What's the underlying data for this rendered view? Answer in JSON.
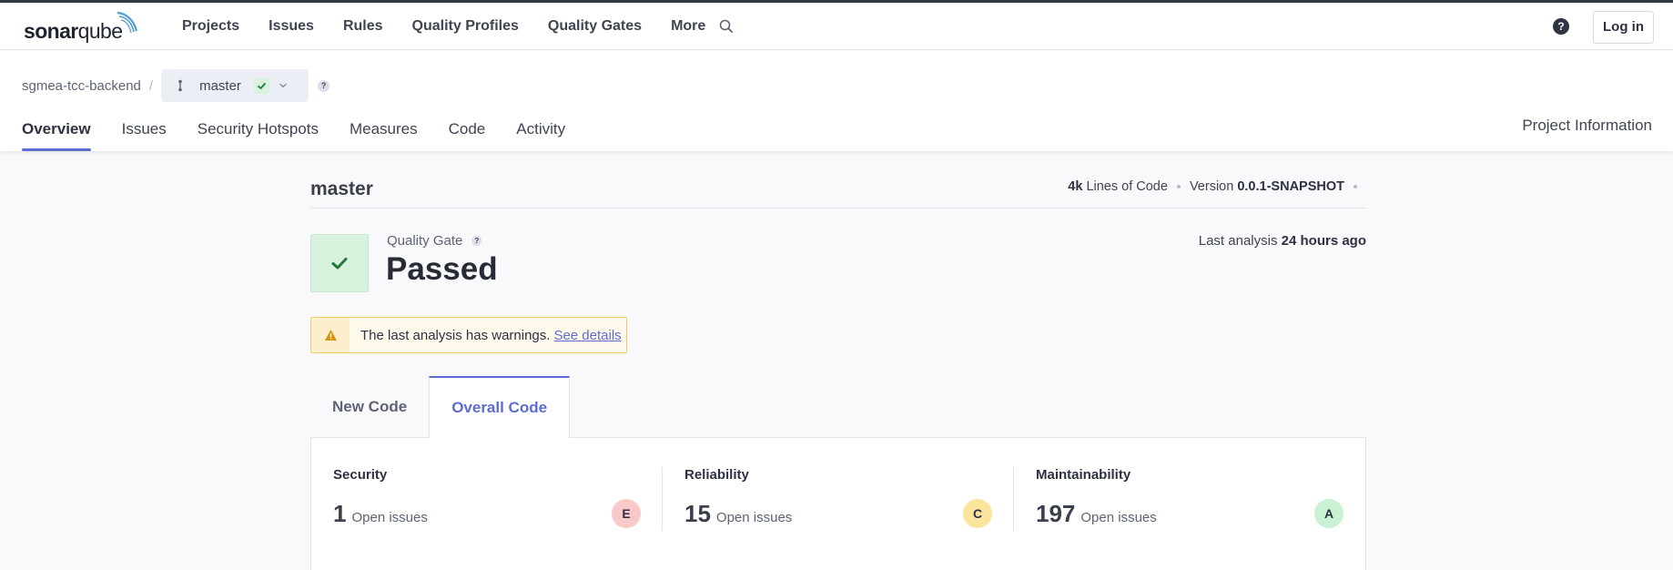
{
  "app": {
    "logo_bold": "sonar",
    "logo_light": "qube"
  },
  "nav": {
    "items": [
      "Projects",
      "Issues",
      "Rules",
      "Quality Profiles",
      "Quality Gates",
      "More"
    ],
    "help_symbol": "?",
    "login_label": "Log in",
    "icons": [
      "search-icon",
      "help-icon"
    ]
  },
  "project": {
    "name": "sgmea-tcc-backend",
    "separator": "/",
    "branch": "master",
    "branch_status_icon": "check-icon",
    "help_symbol": "?",
    "tabs": [
      "Overview",
      "Issues",
      "Security Hotspots",
      "Measures",
      "Code",
      "Activity"
    ],
    "active_tab": "Overview",
    "info_link": "Project Information"
  },
  "overview": {
    "branch_title": "master",
    "loc_value": "4k",
    "loc_label": "Lines of Code",
    "version_label": "Version",
    "version_value": "0.0.1-SNAPSHOT",
    "quality_gate_label": "Quality Gate",
    "quality_gate_status": "Passed",
    "last_analysis_label": "Last analysis",
    "last_analysis_value": "24 hours ago",
    "warning_text": "The last analysis has warnings.",
    "warning_link": "See details",
    "code_tabs": [
      "New Code",
      "Overall Code"
    ],
    "active_code_tab": "Overall Code"
  },
  "metrics": [
    {
      "title": "Security",
      "count": "1",
      "unit": "Open issues",
      "rating": "E",
      "rating_color": "#f9c8c8"
    },
    {
      "title": "Reliability",
      "count": "15",
      "unit": "Open issues",
      "rating": "C",
      "rating_color": "#fbe49b"
    },
    {
      "title": "Maintainability",
      "count": "197",
      "unit": "Open issues",
      "rating": "A",
      "rating_color": "#c9f2d2"
    }
  ],
  "colors": {
    "accent": "#5d6cd0",
    "passed_bg": "#d8f2dd",
    "passed_check": "#1f7a3a",
    "warning_border": "#f2c96b",
    "warning_icon": "#d69211"
  }
}
